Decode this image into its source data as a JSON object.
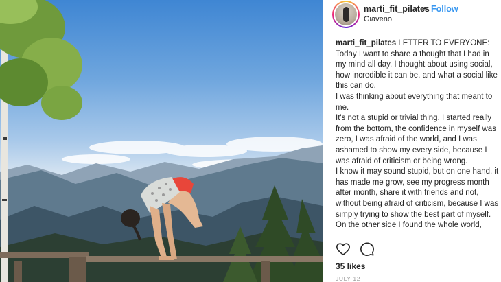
{
  "post": {
    "username": "marti_fit_pilates",
    "separator": "•",
    "follow_label": "Follow",
    "location": "Giaveno",
    "caption_user": "marti_fit_pilates",
    "caption_text": " LETTER TO EVERYONE:\nToday I want to share a thought that I had in my mind all day. I thought about using social, how incredible it can be, and what a social like this can do.\nI was thinking about everything that meant to me.\nIt's not a stupid or trivial thing. I started really from the bottom, the confidence in myself was zero, I was afraid of the world, and I was ashamed to show my every side, because I was afraid of criticism or being wrong.\nI know it may sound stupid, but on one hand, it has made me grow, see my progress month after month, share it with friends and not, without being afraid of criticism, because I was simply trying to show the best part of myself.\nOn the other side I found the whole world,",
    "likes": "35 likes",
    "date": "JULY 12"
  },
  "icons": {
    "like": "heart-icon",
    "comment": "comment-icon"
  },
  "colors": {
    "follow": "#3897f0",
    "text": "#262626",
    "muted": "#999999",
    "divider": "#efefef"
  }
}
